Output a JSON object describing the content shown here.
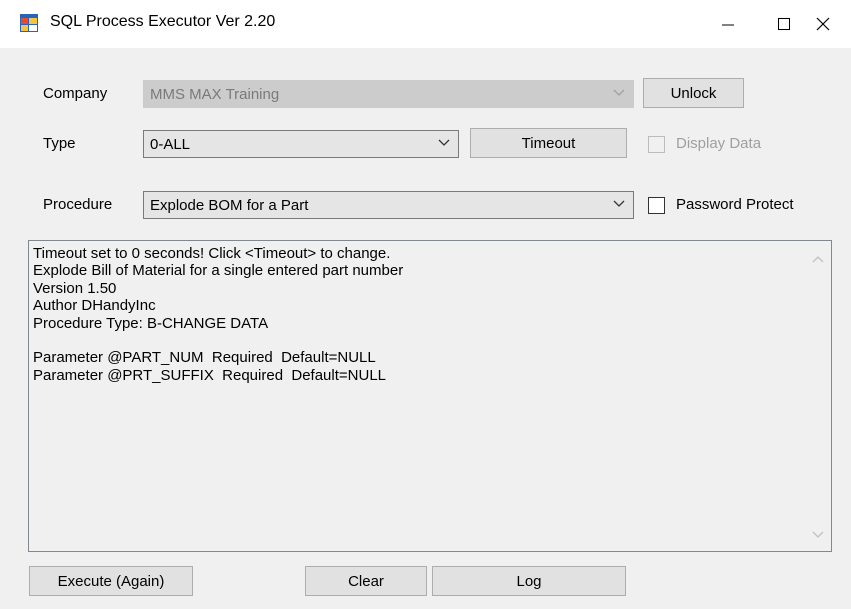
{
  "window": {
    "title": "SQL Process Executor Ver 2.20"
  },
  "form": {
    "company": {
      "label": "Company",
      "value": "MMS MAX Training"
    },
    "unlock_label": "Unlock",
    "type": {
      "label": "Type",
      "value": "0-ALL"
    },
    "timeout_label": "Timeout",
    "display_data_label": "Display Data",
    "procedure": {
      "label": "Procedure",
      "value": "Explode BOM for a Part"
    },
    "password_protect_label": "Password Protect"
  },
  "output": {
    "lines": [
      "Timeout set to 0 seconds! Click <Timeout> to change.",
      "Explode Bill of Material for a single entered part number",
      "Version 1.50",
      "Author DHandyInc",
      "Procedure Type: B-CHANGE DATA",
      "",
      "Parameter @PART_NUM  Required  Default=NULL",
      "Parameter @PRT_SUFFIX  Required  Default=NULL"
    ]
  },
  "buttons": {
    "execute": "Execute (Again)",
    "clear": "Clear",
    "log": "Log"
  },
  "icons": {
    "app": "app-window-icon",
    "minimize": "minimize-icon",
    "maximize": "maximize-icon",
    "close": "close-icon",
    "dropdown": "chevron-down-icon"
  }
}
